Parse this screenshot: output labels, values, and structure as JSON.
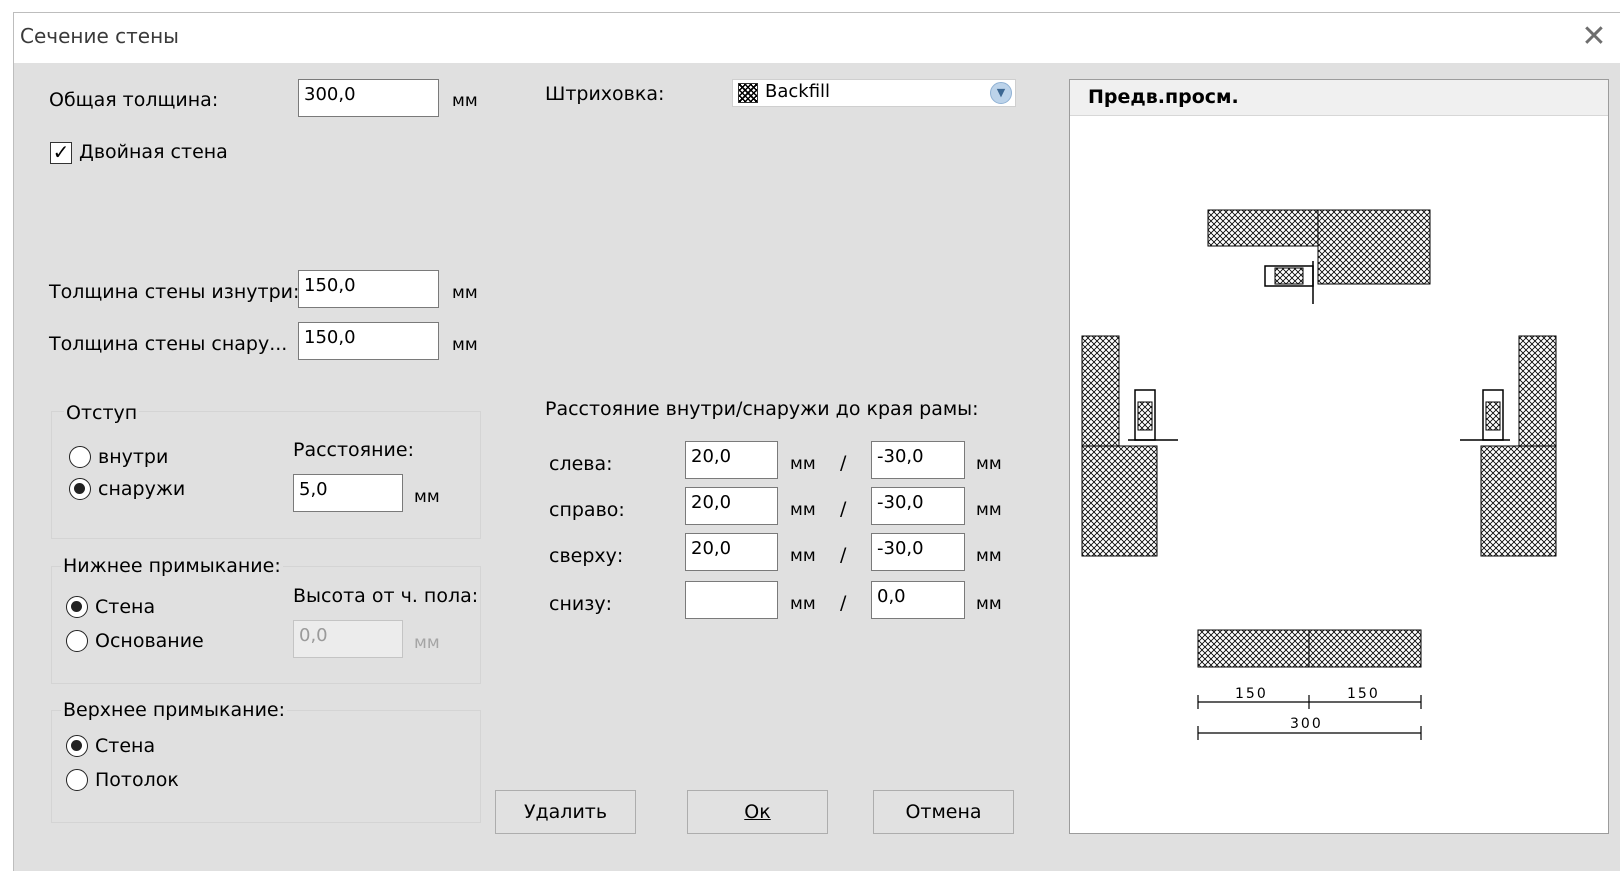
{
  "window": {
    "title": "Сечение стены",
    "close_icon": "close-icon"
  },
  "left": {
    "total_thickness_label": "Общая толщина:",
    "total_thickness_value": "300,0",
    "unit": "мм",
    "double_wall_label": "Двойная стена",
    "double_wall_checked": true,
    "inner_thickness_label": "Толщина стены изнутри:",
    "inner_thickness_value": "150,0",
    "outer_thickness_label": "Толщина стены снару...",
    "outer_thickness_value": "150,0"
  },
  "offset": {
    "group_label": "Отступ",
    "inside_label": "внутри",
    "outside_label": "снаружи",
    "selected": "outside",
    "distance_label": "Расстояние:",
    "distance_value": "5,0",
    "unit": "мм"
  },
  "bottom_junction": {
    "group_label": "Нижнее примыкание:",
    "wall_label": "Стена",
    "base_label": "Основание",
    "selected": "wall",
    "height_label": "Высота от ч. пола:",
    "height_value": "0,0",
    "unit": "мм"
  },
  "top_junction": {
    "group_label": "Верхнее примыкание:",
    "wall_label": "Стена",
    "ceiling_label": "Потолок",
    "selected": "wall"
  },
  "hatch": {
    "label": "Штриховка:",
    "value": "Backfill",
    "icon": "hatch-pattern-icon",
    "dropdown_icon": "chevron-down-icon"
  },
  "frame_distance": {
    "header": "Расстояние внутри/снаружи до края рамы:",
    "unit": "мм",
    "separator": "/",
    "rows": [
      {
        "label": "слева:",
        "inner": "20,0",
        "outer": "-30,0"
      },
      {
        "label": "справо:",
        "inner": "20,0",
        "outer": "-30,0"
      },
      {
        "label": "сверху:",
        "inner": "20,0",
        "outer": "-30,0"
      },
      {
        "label": "снизу:",
        "inner": "",
        "outer": "0,0"
      }
    ]
  },
  "buttons": {
    "delete": "Удалить",
    "ok": "Ок",
    "cancel": "Отмена"
  },
  "preview": {
    "title": "Предв.просм.",
    "dim_left": "150",
    "dim_right": "150",
    "dim_total": "300"
  }
}
